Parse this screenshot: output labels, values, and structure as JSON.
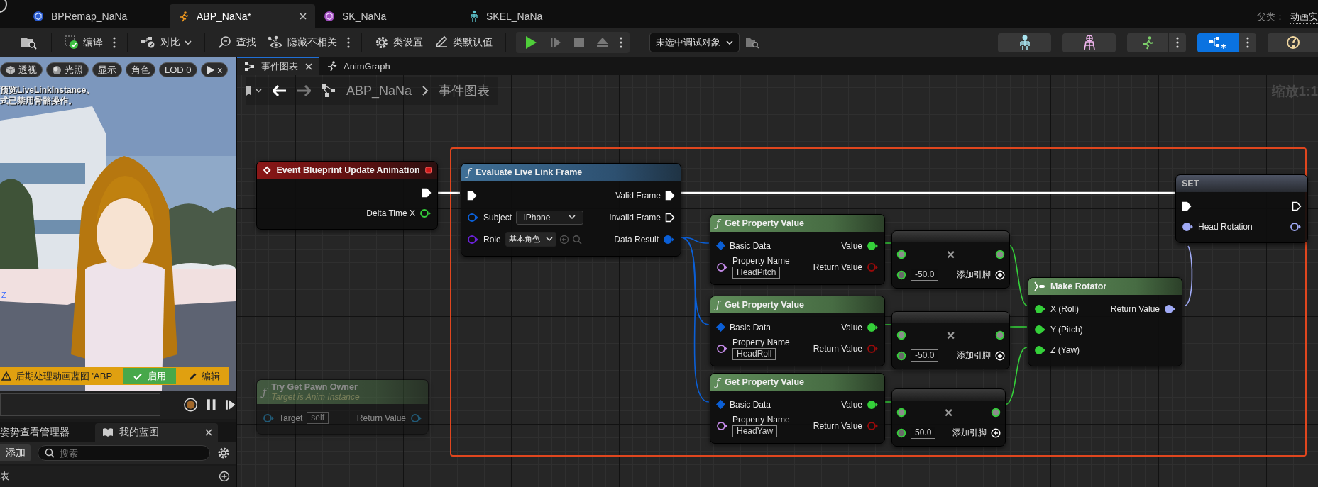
{
  "document_tabs": [
    {
      "label": "BPRemap_NaNa",
      "selected": false
    },
    {
      "label": "ABP_NaNa*",
      "selected": true
    },
    {
      "label": "SK_NaNa",
      "selected": false
    },
    {
      "label": "SKEL_NaNa",
      "selected": false
    }
  ],
  "parent_class": {
    "label": "父类：",
    "value": "动画实"
  },
  "toolbar": {
    "buttons": [
      {
        "label": "编译"
      },
      {
        "label": "对比"
      },
      {
        "label": "查找"
      },
      {
        "label": "隐藏不相关"
      },
      {
        "label": "类设置"
      },
      {
        "label": "类默认值"
      }
    ],
    "debug_target": "未选中调试对象",
    "modes": [
      {
        "selected": false
      },
      {
        "selected": false
      },
      {
        "selected": false
      },
      {
        "selected": true
      },
      {
        "selected": false
      }
    ]
  },
  "viewport": {
    "buttons": [
      "透视",
      "光照",
      "显示",
      "角色",
      "LOD 0",
      "x"
    ],
    "messages": [
      "预览LiveLinkInstance。",
      "式已禁用骨骼操作。"
    ],
    "axis_label": "Z",
    "banner": {
      "text": "后期处理动画蓝图 'ABP_",
      "enable_button": "启用",
      "edit_button": "编辑"
    }
  },
  "left_panel": {
    "tabs": [
      {
        "label": "姿势查看管理器",
        "selected": false
      },
      {
        "label": "我的蓝图",
        "selected": true
      }
    ],
    "add_button": "添加",
    "search": {
      "placeholder": "搜索"
    },
    "section": "表"
  },
  "graph": {
    "tabs": [
      {
        "label": "事件图表",
        "selected": true
      },
      {
        "label": "AnimGraph",
        "selected": false
      }
    ],
    "breadcrumb": [
      "ABP_NaNa",
      "事件图表"
    ],
    "zoom": "缩放1:1",
    "nodes": [
      {
        "kind": "event",
        "title": "Event Blueprint Update Animation",
        "faded": false,
        "rows": [
          {
            "right": {
              "kind": "exec",
              "connected": true
            }
          },
          {
            "right": {
              "label": "Delta Time X",
              "kind": "float",
              "connected": false
            }
          }
        ]
      },
      {
        "kind": "function",
        "icon": "ƒ",
        "title": "Evaluate Live Link Frame",
        "faded": false,
        "rows": [
          {
            "left": {
              "kind": "exec",
              "connected": true
            },
            "right": {
              "label": "Valid Frame",
              "kind": "exec",
              "connected": true
            }
          },
          {
            "left": {
              "label": "Subject",
              "kind": "struct",
              "connected": false,
              "value": "iPhone",
              "dropdown": true
            },
            "right": {
              "label": "Invalid Frame",
              "kind": "exec",
              "connected": false
            }
          },
          {
            "left": {
              "label": "Role",
              "kind": "class",
              "connected": false,
              "value": "基本角色",
              "dropdown": true
            },
            "right": {
              "label": "Data Result",
              "kind": "struct",
              "connected": true
            }
          }
        ]
      },
      {
        "kind": "pure",
        "icon": "ƒ",
        "title": "Get Property Value",
        "faded": false,
        "rows": [
          {
            "left": {
              "label": "Basic Data",
              "kind": "struct_ref",
              "connected": true
            },
            "right": {
              "label": "Value",
              "kind": "float",
              "connected": true
            }
          },
          {
            "left": {
              "label": "Property Name",
              "kind": "name",
              "connected": false,
              "value": "HeadPitch",
              "dropdown": false
            },
            "right": {
              "label": "Return Value",
              "kind": "bool",
              "connected": false
            }
          }
        ]
      },
      {
        "kind": "pure",
        "icon": "ƒ",
        "title": "Get Property Value",
        "faded": false,
        "rows": [
          {
            "left": {
              "label": "Basic Data",
              "kind": "struct_ref",
              "connected": true
            },
            "right": {
              "label": "Value",
              "kind": "float",
              "connected": true
            }
          },
          {
            "left": {
              "label": "Property Name",
              "kind": "name",
              "connected": false,
              "value": "HeadRoll",
              "dropdown": false
            },
            "right": {
              "label": "Return Value",
              "kind": "bool",
              "connected": false
            }
          }
        ]
      },
      {
        "kind": "pure",
        "icon": "ƒ",
        "title": "Get Property Value",
        "faded": false,
        "rows": [
          {
            "left": {
              "label": "Basic Data",
              "kind": "struct_ref",
              "connected": true
            },
            "right": {
              "label": "Value",
              "kind": "float",
              "connected": true
            }
          },
          {
            "left": {
              "label": "Property Name",
              "kind": "name",
              "connected": false,
              "value": "HeadYaw",
              "dropdown": false
            },
            "right": {
              "label": "Return Value",
              "kind": "bool",
              "connected": false
            }
          }
        ]
      },
      {
        "kind": "operator",
        "operator": "×",
        "faded": false,
        "rows": [
          {
            "left": {
              "kind": "operand",
              "connected": true
            },
            "right": {
              "kind": "operand",
              "connected": true
            }
          },
          {
            "left": {
              "kind": "operand",
              "connected": false,
              "value": "-50.0",
              "dropdown": false
            },
            "right": {
              "label": "添加引脚",
              "kind": "add"
            }
          }
        ]
      },
      {
        "kind": "operator",
        "operator": "×",
        "faded": false,
        "rows": [
          {
            "left": {
              "kind": "operand",
              "connected": true
            },
            "right": {
              "kind": "operand",
              "connected": true
            }
          },
          {
            "left": {
              "kind": "operand",
              "connected": false,
              "value": "-50.0",
              "dropdown": false
            },
            "right": {
              "label": "添加引脚",
              "kind": "add"
            }
          }
        ]
      },
      {
        "kind": "operator",
        "operator": "×",
        "faded": false,
        "rows": [
          {
            "left": {
              "kind": "operand",
              "connected": true
            },
            "right": {
              "kind": "operand",
              "connected": true
            }
          },
          {
            "left": {
              "kind": "operand",
              "connected": false,
              "value": "50.0",
              "dropdown": false
            },
            "right": {
              "label": "添加引脚",
              "kind": "add"
            }
          }
        ]
      },
      {
        "kind": "make",
        "title": "Make Rotator",
        "faded": false,
        "rows": [
          {
            "left": {
              "label": "X (Roll)",
              "kind": "float",
              "connected": true
            },
            "right": {
              "label": "Return Value",
              "kind": "rotator",
              "connected": true
            }
          },
          {
            "left": {
              "label": "Y (Pitch)",
              "kind": "float",
              "connected": true
            }
          },
          {
            "left": {
              "label": "Z (Yaw)",
              "kind": "float",
              "connected": true
            }
          }
        ]
      },
      {
        "kind": "set",
        "title": "SET",
        "faded": false,
        "rows": [
          {
            "left": {
              "kind": "exec",
              "connected": true
            },
            "right": {
              "kind": "exec",
              "connected": false
            }
          },
          {
            "left": {
              "label": "Head Rotation",
              "kind": "rotator",
              "connected": true
            },
            "right": {
              "kind": "rotator",
              "connected": false
            }
          }
        ]
      },
      {
        "kind": "pure",
        "icon": "ƒ",
        "title": "Try Get Pawn Owner",
        "subtitle": "Target is Anim Instance",
        "faded": true,
        "rows": [
          {
            "left": {
              "label": "Target",
              "kind": "object",
              "connected": false,
              "value": "self",
              "dropdown": false
            },
            "right": {
              "label": "Return Value",
              "kind": "object",
              "connected": false
            }
          }
        ]
      }
    ]
  }
}
